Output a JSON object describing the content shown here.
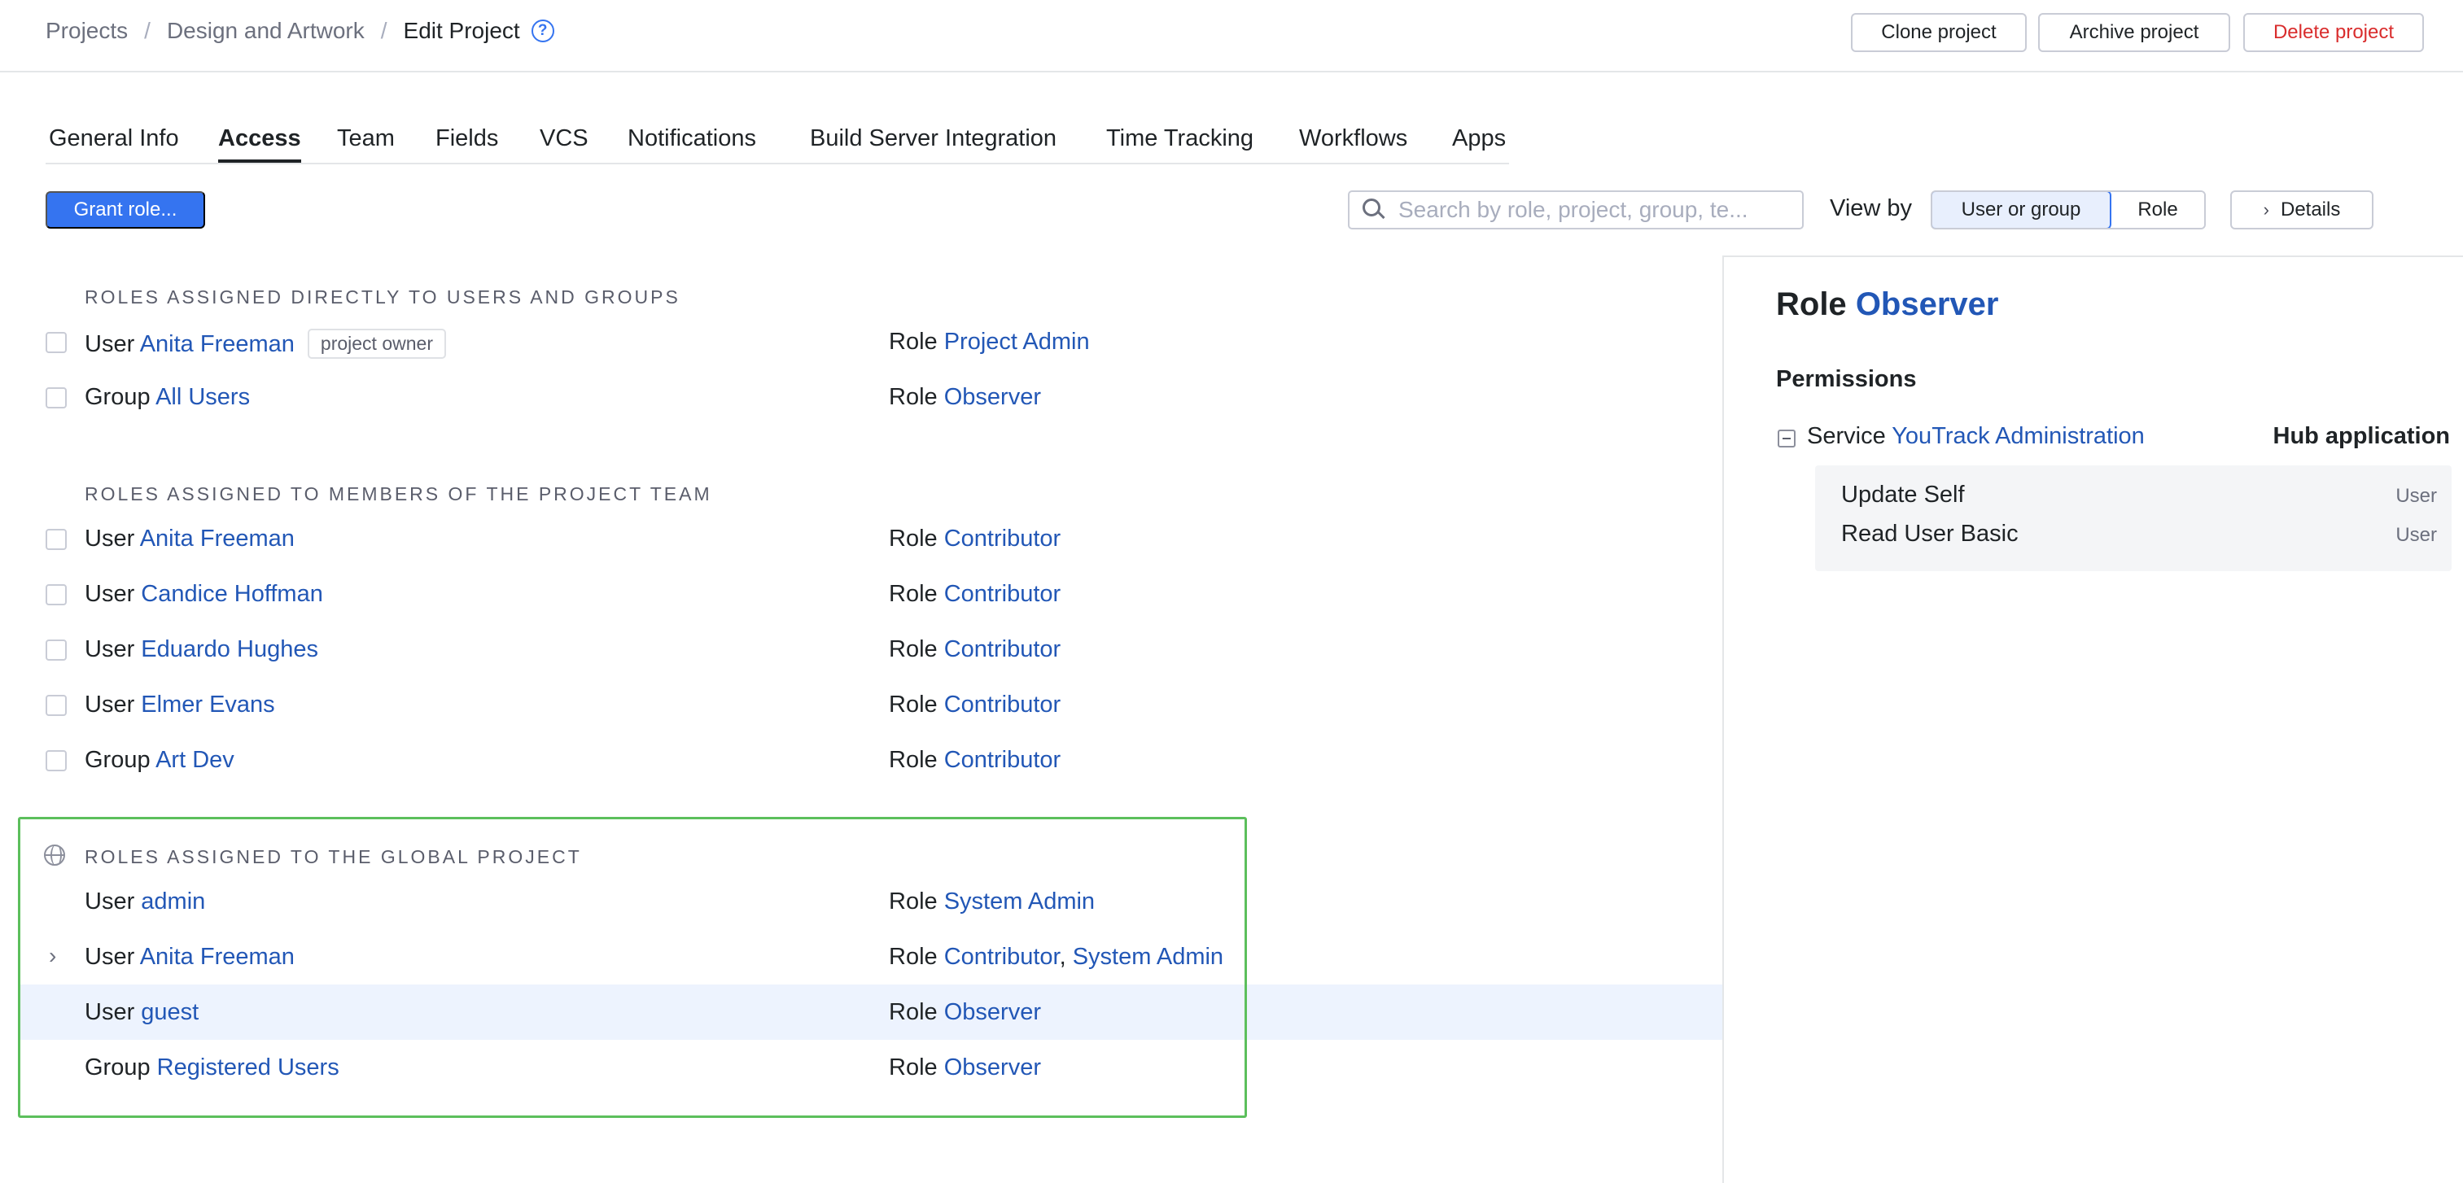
{
  "breadcrumb": {
    "items": [
      "Projects",
      "Design and Artwork"
    ],
    "separator": "/",
    "current": "Edit Project",
    "help": "?"
  },
  "actions": {
    "clone": "Clone project",
    "archive": "Archive project",
    "delete": "Delete project"
  },
  "tabs": [
    {
      "label": "General Info",
      "active": false
    },
    {
      "label": "Access",
      "active": true
    },
    {
      "label": "Team",
      "active": false
    },
    {
      "label": "Fields",
      "active": false
    },
    {
      "label": "VCS",
      "active": false
    },
    {
      "label": "Notifications",
      "active": false
    },
    {
      "label": "Build Server Integration",
      "active": false
    },
    {
      "label": "Time Tracking",
      "active": false
    },
    {
      "label": "Workflows",
      "active": false
    },
    {
      "label": "Apps",
      "active": false
    }
  ],
  "toolbar": {
    "grant_label": "Grant role...",
    "search_placeholder": "Search by role, project, group, te...",
    "view_by_label": "View by",
    "view_options": [
      "User or group",
      "Role"
    ],
    "view_selected": "User or group",
    "details_label": "Details"
  },
  "sections": {
    "direct": {
      "header": "Roles assigned directly to users and groups",
      "rows": [
        {
          "type": "User",
          "name": "Anita Freeman",
          "badge": "project owner",
          "role_prefix": "Role",
          "role": "Project Admin"
        },
        {
          "type": "Group",
          "name": "All Users",
          "role_prefix": "Role",
          "role": "Observer"
        }
      ]
    },
    "team": {
      "header": "Roles assigned to members of the project team",
      "rows": [
        {
          "type": "User",
          "name": "Anita Freeman",
          "role_prefix": "Role",
          "role": "Contributor"
        },
        {
          "type": "User",
          "name": "Candice Hoffman",
          "role_prefix": "Role",
          "role": "Contributor"
        },
        {
          "type": "User",
          "name": "Eduardo Hughes",
          "role_prefix": "Role",
          "role": "Contributor"
        },
        {
          "type": "User",
          "name": "Elmer Evans",
          "role_prefix": "Role",
          "role": "Contributor"
        },
        {
          "type": "Group",
          "name": "Art Dev",
          "role_prefix": "Role",
          "role": "Contributor"
        }
      ]
    },
    "global": {
      "header": "Roles assigned to the global project",
      "rows": [
        {
          "type": "User",
          "name": "admin",
          "role_prefix": "Role",
          "role": "System Admin"
        },
        {
          "type": "User",
          "name": "Anita Freeman",
          "role_prefix": "Role",
          "role": "Contributor",
          "role_sep": ", ",
          "role2": "System Admin",
          "expandable": true
        },
        {
          "type": "User",
          "name": "guest",
          "role_prefix": "Role",
          "role": "Observer",
          "highlighted": true
        },
        {
          "type": "Group",
          "name": "Registered Users",
          "role_prefix": "Role",
          "role": "Observer"
        }
      ]
    }
  },
  "details_panel": {
    "title_prefix": "Role",
    "title_role": "Observer",
    "permissions_label": "Permissions",
    "service_prefix": "Service",
    "service_name": "YouTrack Administration",
    "service_type": "Hub application",
    "permissions": [
      {
        "name": "Update Self",
        "scope": "User"
      },
      {
        "name": "Read User Basic",
        "scope": "User"
      }
    ]
  },
  "colors": {
    "accent": "#3574f0",
    "link": "#2257b6",
    "danger": "#d92d2d",
    "highlight_row": "#edf3fe",
    "global_section_outline": "#5cbf5c"
  },
  "icons": [
    "help-icon",
    "search-icon",
    "chevron-right-icon",
    "globe-icon",
    "collapse-icon"
  ]
}
